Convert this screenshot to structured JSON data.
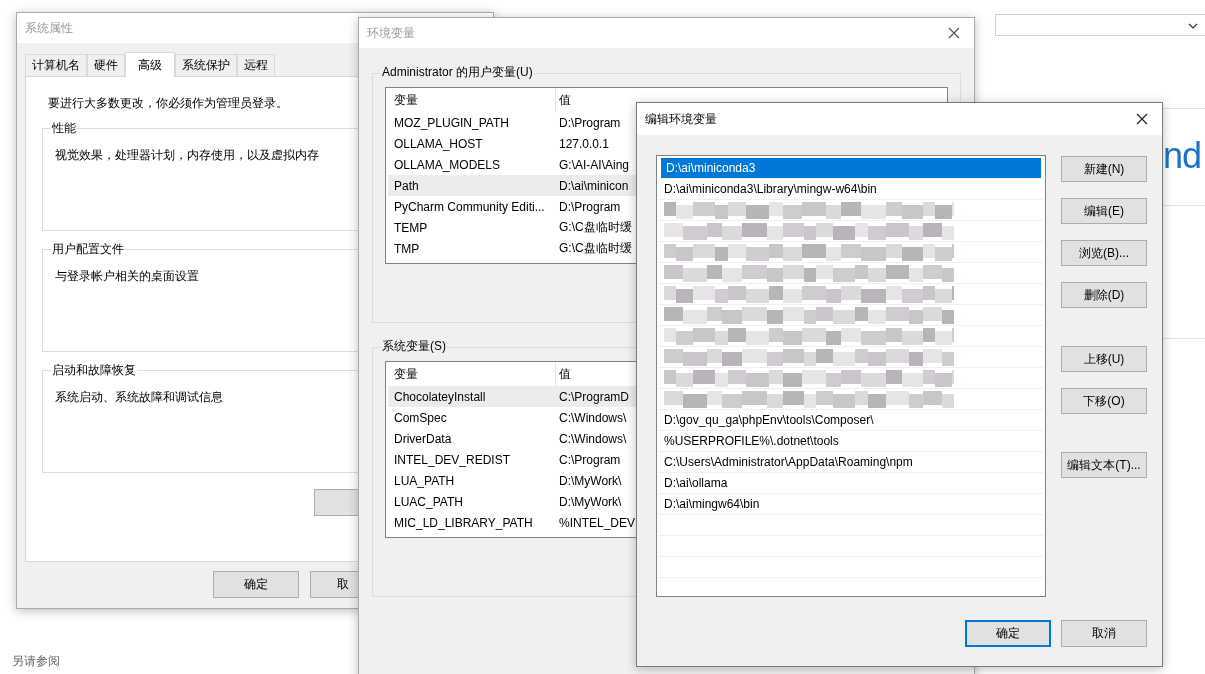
{
  "background": {
    "logo_fragment": "nd",
    "see_also": "另请参阅"
  },
  "system_properties": {
    "title": "系统属性",
    "tabs": [
      {
        "label": "计算机名",
        "selected": false
      },
      {
        "label": "硬件",
        "selected": false
      },
      {
        "label": "高级",
        "selected": true
      },
      {
        "label": "系统保护",
        "selected": false
      },
      {
        "label": "远程",
        "selected": false
      }
    ],
    "notice": "要进行大多数更改，你必须作为管理员登录。",
    "groups": [
      {
        "title": "性能",
        "description": "视觉效果，处理器计划，内存使用，以及虚拟内存"
      },
      {
        "title": "用户配置文件",
        "description": "与登录帐户相关的桌面设置"
      },
      {
        "title": "启动和故障恢复",
        "description": "系统启动、系统故障和调试信息"
      }
    ],
    "buttons": [
      "确定",
      "取"
    ]
  },
  "environment_variables": {
    "title": "环境变量",
    "user_group": {
      "title": "Administrator 的用户变量(U)",
      "columns": [
        "变量",
        "值"
      ],
      "rows": [
        {
          "name": "MOZ_PLUGIN_PATH",
          "value": "D:\\Program",
          "selected": false
        },
        {
          "name": "OLLAMA_HOST",
          "value": "127.0.0.1",
          "selected": false
        },
        {
          "name": "OLLAMA_MODELS",
          "value": "G:\\AI-AI\\Aing",
          "selected": false
        },
        {
          "name": "Path",
          "value": "D:\\ai\\minicon",
          "selected": true
        },
        {
          "name": "PyCharm Community Editi...",
          "value": "D:\\Program",
          "selected": false
        },
        {
          "name": "TEMP",
          "value": "G:\\C盘临时缓",
          "selected": false
        },
        {
          "name": "TMP",
          "value": "G:\\C盘临时缓",
          "selected": false
        }
      ]
    },
    "system_group": {
      "title": "系统变量(S)",
      "columns": [
        "变量",
        "值"
      ],
      "rows": [
        {
          "name": "ChocolateyInstall",
          "value": "C:\\ProgramD",
          "selected": true
        },
        {
          "name": "ComSpec",
          "value": "C:\\Windows\\",
          "selected": false
        },
        {
          "name": "DriverData",
          "value": "C:\\Windows\\",
          "selected": false
        },
        {
          "name": "INTEL_DEV_REDIST",
          "value": "C:\\Program",
          "selected": false
        },
        {
          "name": "LUA_PATH",
          "value": "D:\\MyWork\\",
          "selected": false
        },
        {
          "name": "LUAC_PATH",
          "value": "D:\\MyWork\\",
          "selected": false
        },
        {
          "name": "MIC_LD_LIBRARY_PATH",
          "value": "%INTEL_DEV",
          "selected": false
        }
      ]
    }
  },
  "edit_dialog": {
    "title": "编辑环境变量",
    "entries": [
      {
        "kind": "text",
        "text": "D:\\ai\\miniconda3",
        "selected": true
      },
      {
        "kind": "text",
        "text": "D:\\ai\\miniconda3\\Library\\mingw-w64\\bin",
        "selected": false
      },
      {
        "kind": "blurred",
        "selected": false
      },
      {
        "kind": "blurred",
        "selected": false
      },
      {
        "kind": "blurred",
        "selected": false
      },
      {
        "kind": "blurred",
        "selected": false
      },
      {
        "kind": "blurred",
        "selected": false
      },
      {
        "kind": "blurred",
        "selected": false
      },
      {
        "kind": "blurred",
        "selected": false
      },
      {
        "kind": "blurred",
        "selected": false
      },
      {
        "kind": "blurred",
        "selected": false
      },
      {
        "kind": "blurred",
        "selected": false
      },
      {
        "kind": "text",
        "text": "D:\\gov_qu_ga\\phpEnv\\tools\\Composer\\",
        "selected": false
      },
      {
        "kind": "text",
        "text": "%USERPROFILE%\\.dotnet\\tools",
        "selected": false
      },
      {
        "kind": "text",
        "text": "C:\\Users\\Administrator\\AppData\\Roaming\\npm",
        "selected": false
      },
      {
        "kind": "text",
        "text": "D:\\ai\\ollama",
        "selected": false
      },
      {
        "kind": "text",
        "text": "D:\\ai\\mingw64\\bin",
        "selected": false
      }
    ],
    "side_button_groups": [
      [
        "新建(N)",
        "编辑(E)",
        "浏览(B)...",
        "删除(D)"
      ],
      [
        "上移(U)",
        "下移(O)"
      ],
      [
        "编辑文本(T)..."
      ]
    ],
    "footer_buttons": [
      {
        "label": "确定",
        "default": true
      },
      {
        "label": "取消",
        "default": false
      }
    ]
  }
}
